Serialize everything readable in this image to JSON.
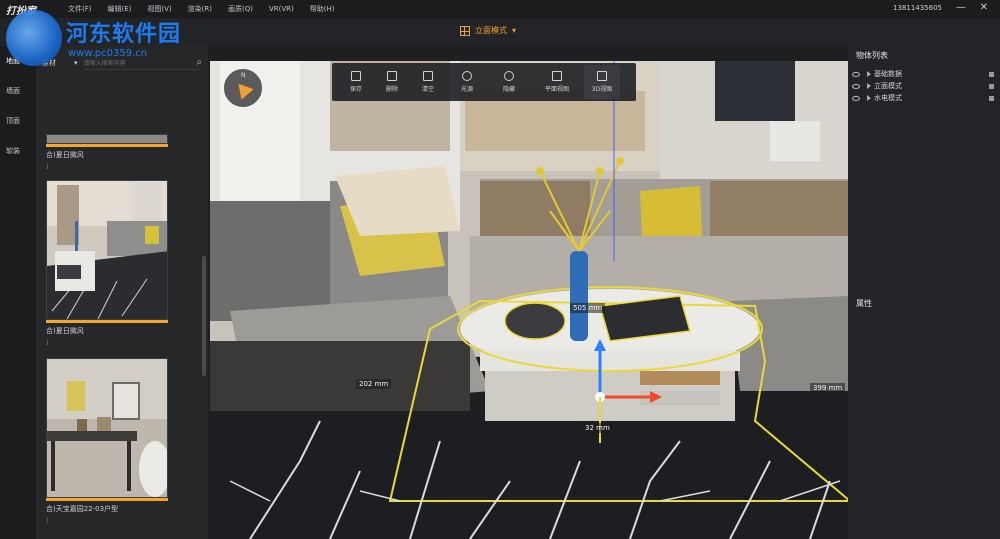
{
  "app": {
    "logo": "打扮家",
    "menu": [
      "文件(F)",
      "编辑(E)",
      "视图(V)",
      "渲染(R)",
      "画质(Q)",
      "VR(VR)",
      "帮助(H)"
    ],
    "phone": "13811435605",
    "minimize": "—",
    "close": "✕"
  },
  "watermark": {
    "title": "河东软件园",
    "url": "www.pc0359.cn"
  },
  "mode": {
    "label": "立面模式",
    "arrow": "▾"
  },
  "left_tabs": [
    "地面",
    "墙面",
    "顶面",
    "软装"
  ],
  "library": {
    "category": "素材",
    "category_arrow": "▾",
    "search_placeholder": "请输入搜索内容",
    "search_icon": "⌕",
    "cards": [
      {
        "label": "合)夏日微风",
        "sub": "〕"
      },
      {
        "label": "合)夏日微风",
        "sub": "〕"
      },
      {
        "label": "合)天宝嘉园22-03户型",
        "sub": "〕"
      }
    ]
  },
  "viewport": {
    "compass_n": "N",
    "toolbar": [
      {
        "label": "保存",
        "icon": "save-icon"
      },
      {
        "label": "删除",
        "icon": "trash-icon"
      },
      {
        "label": "清空",
        "icon": "clear-icon"
      },
      {
        "label": "光源",
        "icon": "light-icon"
      },
      {
        "label": "隐藏",
        "icon": "eye-icon"
      },
      {
        "label": "平面视图",
        "icon": "plan-view-icon"
      },
      {
        "label": "3D视图",
        "icon": "3d-view-icon"
      }
    ],
    "dimensions": {
      "left": "202 mm",
      "right": "399 mm",
      "top": "505 mm",
      "bottom": "32 mm"
    }
  },
  "right_panel": {
    "title": "物体列表",
    "tree": [
      "基础数据",
      "立面模式",
      "水电模式"
    ],
    "attributes_title": "属性"
  }
}
